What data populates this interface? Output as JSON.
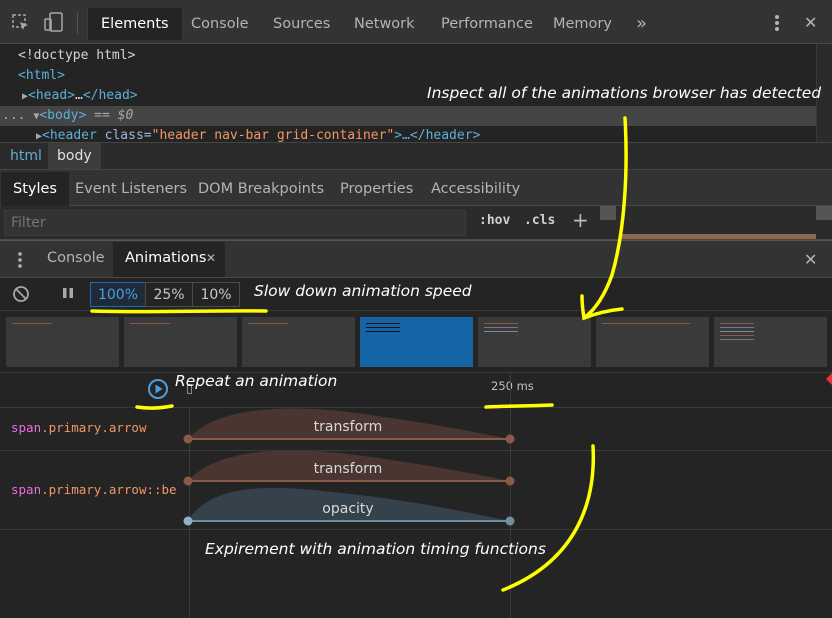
{
  "topbar": {
    "tabs": [
      "Elements",
      "Console",
      "Sources",
      "Network",
      "Performance",
      "Memory"
    ],
    "more": "»",
    "close": "✕"
  },
  "dom": {
    "line1": "<!doctype html>",
    "line2_tag": "<html>",
    "line3_tag_open": "<head>",
    "line3_ellipsis": "…",
    "line3_tag_close": "</head>",
    "line4_dots": "...",
    "line4_tag": "<body>",
    "line4_eq": "== $0",
    "line5_open": "<header ",
    "line5_attr": "class=",
    "line5_val": "\"header nav-bar grid-container\"",
    "line5_close": ">…</header>"
  },
  "breadcrumb": {
    "items": [
      "html",
      "body"
    ]
  },
  "styles_tabs": [
    "Styles",
    "Event Listeners",
    "DOM Breakpoints",
    "Properties",
    "Accessibility"
  ],
  "filter": {
    "placeholder": "Filter",
    "hov": ":hov",
    "cls": ".cls",
    "add": "+"
  },
  "drawer": {
    "tabs": [
      "Console",
      "Animations"
    ],
    "tab_close": "✕",
    "close": "✕"
  },
  "controls": {
    "speeds": [
      "100%",
      "25%",
      "10%"
    ],
    "active_speed": "100%"
  },
  "timeline": {
    "tick_label": "250 ms",
    "rows": [
      {
        "selector_tag": "span",
        "selector_class": ".primary.arrow",
        "animations": [
          "transform"
        ]
      },
      {
        "selector_tag": "span",
        "selector_class": ".primary.arrow::be",
        "animations": [
          "transform",
          "opacity"
        ]
      }
    ]
  },
  "annotations": {
    "inspect": "Inspect all of the animations browser has detected",
    "slow": "Slow down animation speed",
    "repeat": "Repeat an animation",
    "experiment": "Expirement with animation timing functions"
  },
  "colors": {
    "accent": "#1a73e8",
    "highlight_yellow": "#ffff00",
    "transform_curve": "#8a5a48",
    "opacity_curve": "#6f8fa3"
  }
}
